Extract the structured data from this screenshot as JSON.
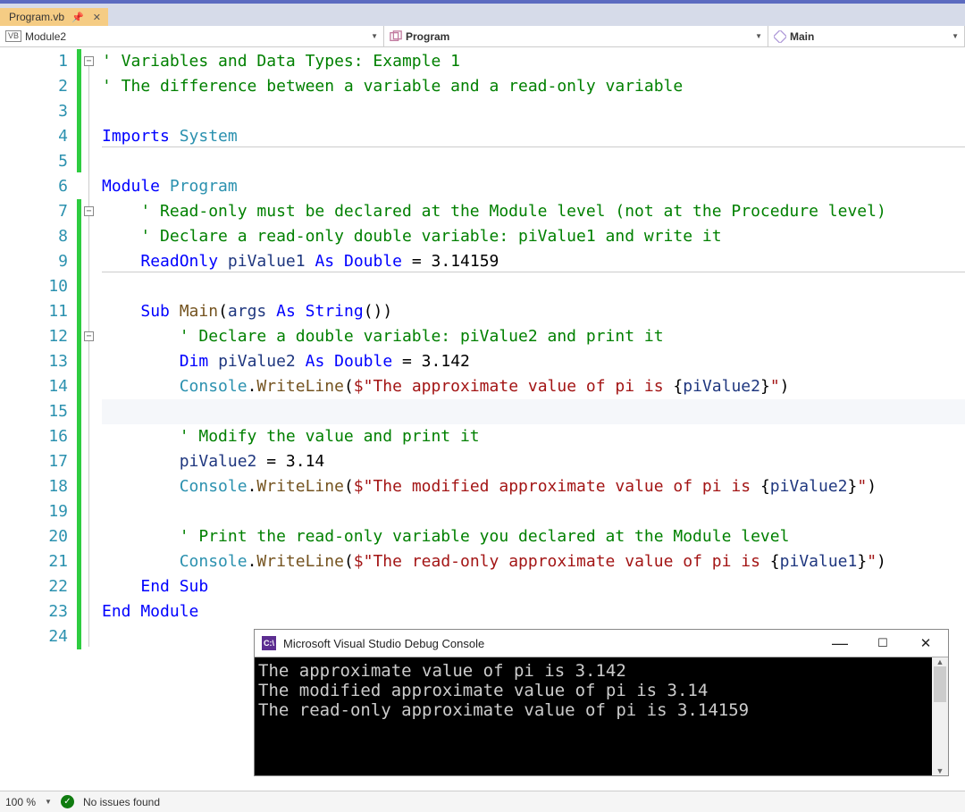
{
  "tab": {
    "name": "Program.vb"
  },
  "nav": {
    "scope": "Module2",
    "type": "Program",
    "member": "Main"
  },
  "code": {
    "lines": [
      "' Variables and Data Types: Example 1",
      "' The difference between a variable and a read-only variable",
      "",
      "Imports System",
      "",
      "Module Program",
      "    ' Read-only must be declared at the Module level (not at the Procedure level)",
      "    ' Declare a read-only double variable: piValue1 and write it",
      "    ReadOnly piValue1 As Double = 3.14159",
      "",
      "    Sub Main(args As String())",
      "        ' Declare a double variable: piValue2 and print it",
      "        Dim piValue2 As Double = 3.142",
      "        Console.WriteLine($\"The approximate value of pi is {piValue2}\")",
      "",
      "        ' Modify the value and print it",
      "        piValue2 = 3.14",
      "        Console.WriteLine($\"The modified approximate value of pi is {piValue2}\")",
      "",
      "        ' Print the read-only variable you declared at the Module level",
      "        Console.WriteLine($\"The read-only approximate value of pi is {piValue1}\")",
      "    End Sub",
      "End Module",
      ""
    ]
  },
  "console": {
    "title": "Microsoft Visual Studio Debug Console",
    "output": "The approximate value of pi is 3.142\nThe modified approximate value of pi is 3.14\nThe read-only approximate value of pi is 3.14159"
  },
  "status": {
    "zoom": "100 %",
    "issues": "No issues found"
  }
}
